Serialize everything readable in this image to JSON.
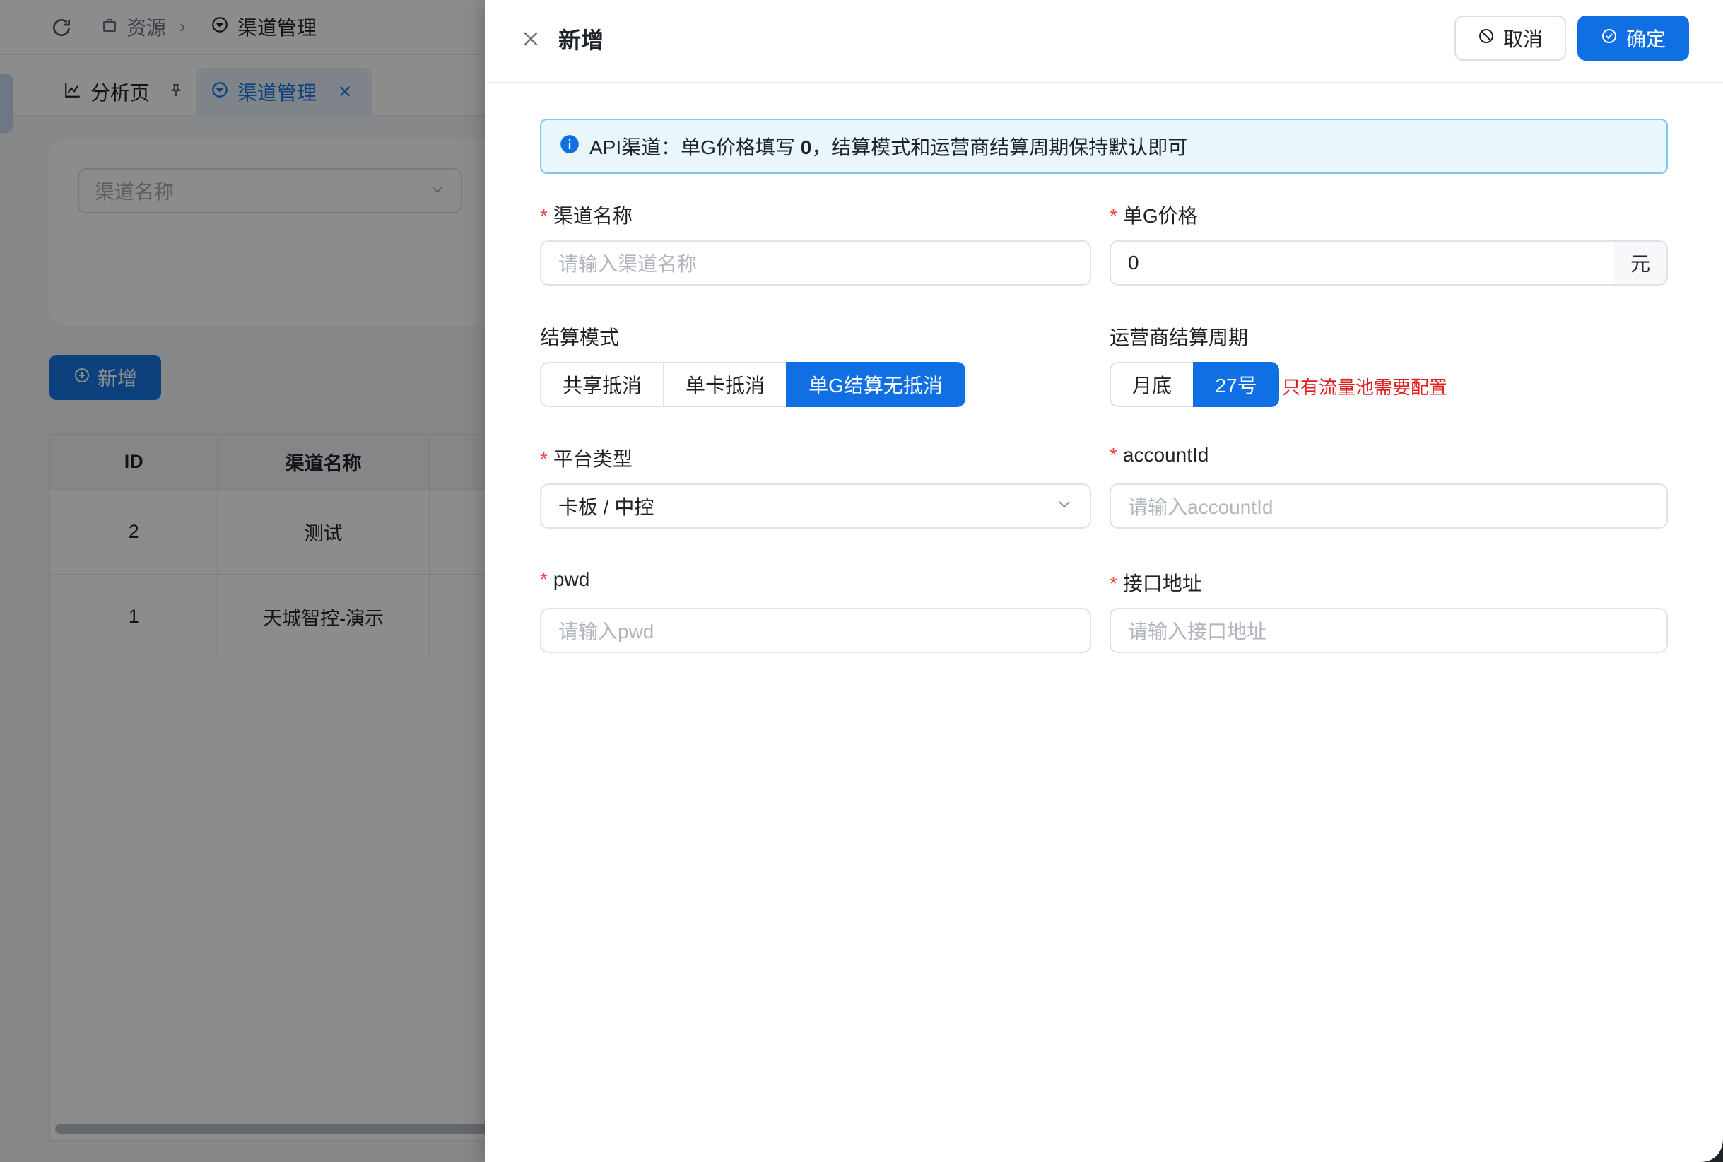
{
  "background": {
    "breadcrumb": {
      "item1": "资源",
      "item2": "渠道管理"
    },
    "tabs": [
      {
        "label": "分析页"
      },
      {
        "label": "渠道管理"
      }
    ],
    "search": {
      "placeholder": "渠道名称"
    },
    "add_button": "新增",
    "table": {
      "headers": [
        "ID",
        "渠道名称"
      ],
      "rows": [
        {
          "id": "2",
          "name": "测试"
        },
        {
          "id": "1",
          "name": "天城智控-演示"
        }
      ]
    }
  },
  "drawer": {
    "title": "新增",
    "cancel_label": "取消",
    "confirm_label": "确定",
    "alert": {
      "prefix": "API渠道：单G价格填写 ",
      "bold": "0",
      "suffix": "，结算模式和运营商结算周期保持默认即可"
    },
    "fields": {
      "channel_name": {
        "label": "渠道名称",
        "placeholder": "请输入渠道名称"
      },
      "unit_price": {
        "label": "单G价格",
        "value": "0",
        "unit": "元"
      },
      "settle_mode": {
        "label": "结算模式",
        "options": [
          "共享抵消",
          "单卡抵消",
          "单G结算无抵消"
        ],
        "selected": "单G结算无抵消"
      },
      "carrier_cycle": {
        "label": "运营商结算周期",
        "options": [
          "月底",
          "27号"
        ],
        "selected": "27号",
        "note": "只有流量池需要配置"
      },
      "platform_type": {
        "label": "平台类型",
        "value": "卡板 / 中控"
      },
      "account_id": {
        "label": "accountId",
        "placeholder": "请输入accountId"
      },
      "pwd": {
        "label": "pwd",
        "placeholder": "请输入pwd"
      },
      "api_url": {
        "label": "接口地址",
        "placeholder": "请输入接口地址"
      }
    }
  },
  "colors": {
    "primary": "#0f6fe3",
    "required": "#ef4444",
    "note": "#e11d1d",
    "alert_bg": "#e9f7fd"
  }
}
